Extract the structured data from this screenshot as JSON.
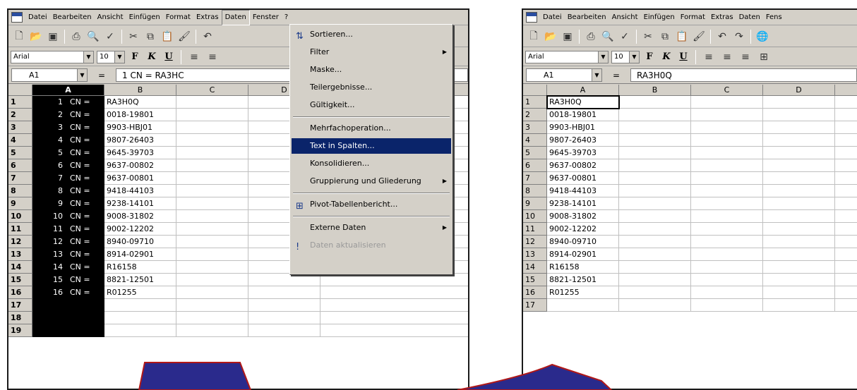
{
  "menubar": {
    "items": [
      "Datei",
      "Bearbeiten",
      "Ansicht",
      "Einfügen",
      "Format",
      "Extras",
      "Daten",
      "Fenster",
      "?"
    ],
    "right_items": [
      "Datei",
      "Bearbeiten",
      "Ansicht",
      "Einfügen",
      "Format",
      "Extras",
      "Daten",
      "Fens"
    ]
  },
  "toolbar": {
    "icons": [
      "new-icon",
      "open-icon",
      "save-icon",
      "print-icon",
      "preview-icon",
      "spelling-icon",
      "cut-icon",
      "copy-icon",
      "paste-icon",
      "format-painter-icon",
      "undo-icon",
      "redo-icon"
    ]
  },
  "formatting": {
    "font": "Arial",
    "size": "10",
    "bold": "F",
    "italic": "K",
    "underline": "U"
  },
  "left": {
    "namebox": "A1",
    "formula_eq": "=",
    "formula": "1   CN = RA3HC",
    "columns": [
      "A",
      "B",
      "C",
      "D"
    ],
    "rows": [
      {
        "n": "1",
        "a": "1",
        "b": "RA3H0Q"
      },
      {
        "n": "2",
        "a": "2",
        "b": "0018-19801"
      },
      {
        "n": "3",
        "a": "3",
        "b": "9903-HBJ01"
      },
      {
        "n": "4",
        "a": "4",
        "b": "9807-26403"
      },
      {
        "n": "5",
        "a": "5",
        "b": "9645-39703"
      },
      {
        "n": "6",
        "a": "6",
        "b": "9637-00802"
      },
      {
        "n": "7",
        "a": "7",
        "b": "9637-00801"
      },
      {
        "n": "8",
        "a": "8",
        "b": "9418-44103"
      },
      {
        "n": "9",
        "a": "9",
        "b": "9238-14101"
      },
      {
        "n": "10",
        "a": "10",
        "b": "9008-31802"
      },
      {
        "n": "11",
        "a": "11",
        "b": "9002-12202"
      },
      {
        "n": "12",
        "a": "12",
        "b": "8940-09710"
      },
      {
        "n": "13",
        "a": "13",
        "b": "8914-02901"
      },
      {
        "n": "14",
        "a": "14",
        "b": "R16158"
      },
      {
        "n": "15",
        "a": "15",
        "b": "8821-12501"
      },
      {
        "n": "16",
        "a": "16",
        "b": "R01255"
      },
      {
        "n": "17",
        "a": "",
        "b": ""
      },
      {
        "n": "18",
        "a": "",
        "b": ""
      },
      {
        "n": "19",
        "a": "",
        "b": ""
      }
    ],
    "cn_label": "CN ="
  },
  "data_menu": {
    "items": [
      {
        "label": "Sortieren...",
        "icon": "sort-icon"
      },
      {
        "label": "Filter",
        "submenu": true
      },
      {
        "label": "Maske..."
      },
      {
        "label": "Teilergebnisse..."
      },
      {
        "label": "Gültigkeit..."
      },
      {
        "label": "Mehrfachoperation..."
      },
      {
        "label": "Text in Spalten...",
        "highlighted": true
      },
      {
        "label": "Konsolidieren..."
      },
      {
        "label": "Gruppierung und Gliederung",
        "submenu": true
      },
      {
        "label": "Pivot-Tabellenbericht...",
        "icon": "pivot-icon"
      },
      {
        "label": "Externe Daten",
        "submenu": true
      },
      {
        "label": "Daten aktualisieren",
        "disabled": true,
        "icon": "refresh-icon"
      }
    ]
  },
  "right": {
    "namebox": "A1",
    "formula_eq": "=",
    "formula": "RA3H0Q",
    "columns": [
      "A",
      "B",
      "C",
      "D"
    ],
    "rows": [
      {
        "n": "1",
        "a": "RA3H0Q"
      },
      {
        "n": "2",
        "a": "0018-19801"
      },
      {
        "n": "3",
        "a": "9903-HBJ01"
      },
      {
        "n": "4",
        "a": "9807-26403"
      },
      {
        "n": "5",
        "a": "9645-39703"
      },
      {
        "n": "6",
        "a": "9637-00802"
      },
      {
        "n": "7",
        "a": "9637-00801"
      },
      {
        "n": "8",
        "a": "9418-44103"
      },
      {
        "n": "9",
        "a": "9238-14101"
      },
      {
        "n": "10",
        "a": "9008-31802"
      },
      {
        "n": "11",
        "a": "9002-12202"
      },
      {
        "n": "12",
        "a": "8940-09710"
      },
      {
        "n": "13",
        "a": "8914-02901"
      },
      {
        "n": "14",
        "a": "R16158"
      },
      {
        "n": "15",
        "a": "8821-12501"
      },
      {
        "n": "16",
        "a": "R01255"
      },
      {
        "n": "17",
        "a": ""
      }
    ]
  },
  "colors": {
    "chrome": "#d4d0c8",
    "selection": "#000000",
    "menu_highlight": "#0a246a",
    "arrow_fill": "#2a2a8c",
    "arrow_stroke": "#b01818"
  }
}
